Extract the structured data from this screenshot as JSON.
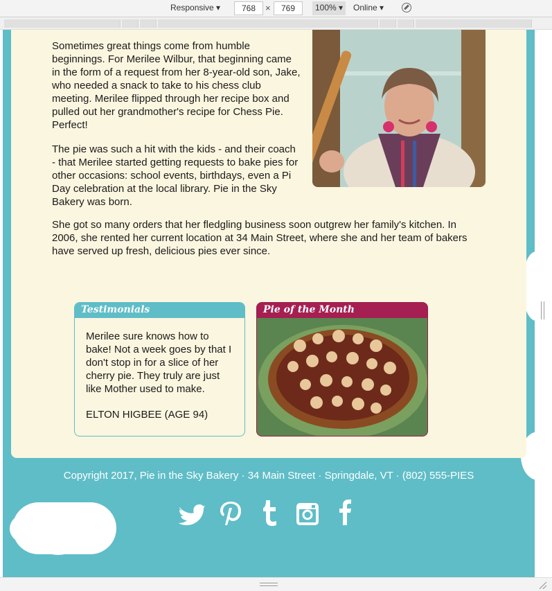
{
  "devtools": {
    "device": "Responsive",
    "width": "768",
    "height": "769",
    "zoom": "100%",
    "throttle": "Online"
  },
  "about": {
    "paragraph1": "Sometimes great things come from humble beginnings. For Merilee Wilbur, that beginning came in the form of a request from her 8-year-old son, Jake, who needed a snack to take to his chess club meeting. Merilee flipped through her recipe box and pulled out her grandmother's recipe for Chess Pie. Perfect!",
    "paragraph2": "The pie was such a hit with the kids - and their coach - that Merilee started getting requests to bake pies for other occasions: school events, birthdays, even a Pi Day celebration at the local library. Pie in the Sky Bakery was born.",
    "paragraph3": "She got so many orders that her fledgling business soon outgrew her family's kitchen. In 2006, she rented her current location at 34 Main Street, where she and her team of bakers have served up fresh, delicious pies ever since."
  },
  "testimonials": {
    "heading": "Testimonials",
    "quote": "Merilee sure knows how to bake! Not a week goes by that I don't stop in for a slice of her cherry pie. They truly are just like Mother used to make.",
    "author": "ELTON HIGBEE (AGE 94)"
  },
  "pie_of_month": {
    "heading": "Pie of the Month"
  },
  "footer": {
    "copyright": "Copyright 2017, Pie in the Sky Bakery · 34 Main Street · Springdale, VT · (802) 555-PIES"
  },
  "social_icons": [
    "twitter-icon",
    "pinterest-icon",
    "tumblr-icon",
    "instagram-icon",
    "facebook-icon"
  ],
  "colors": {
    "teal": "#5fbdc7",
    "cream": "#fbf6df",
    "berry": "#a51f52"
  }
}
